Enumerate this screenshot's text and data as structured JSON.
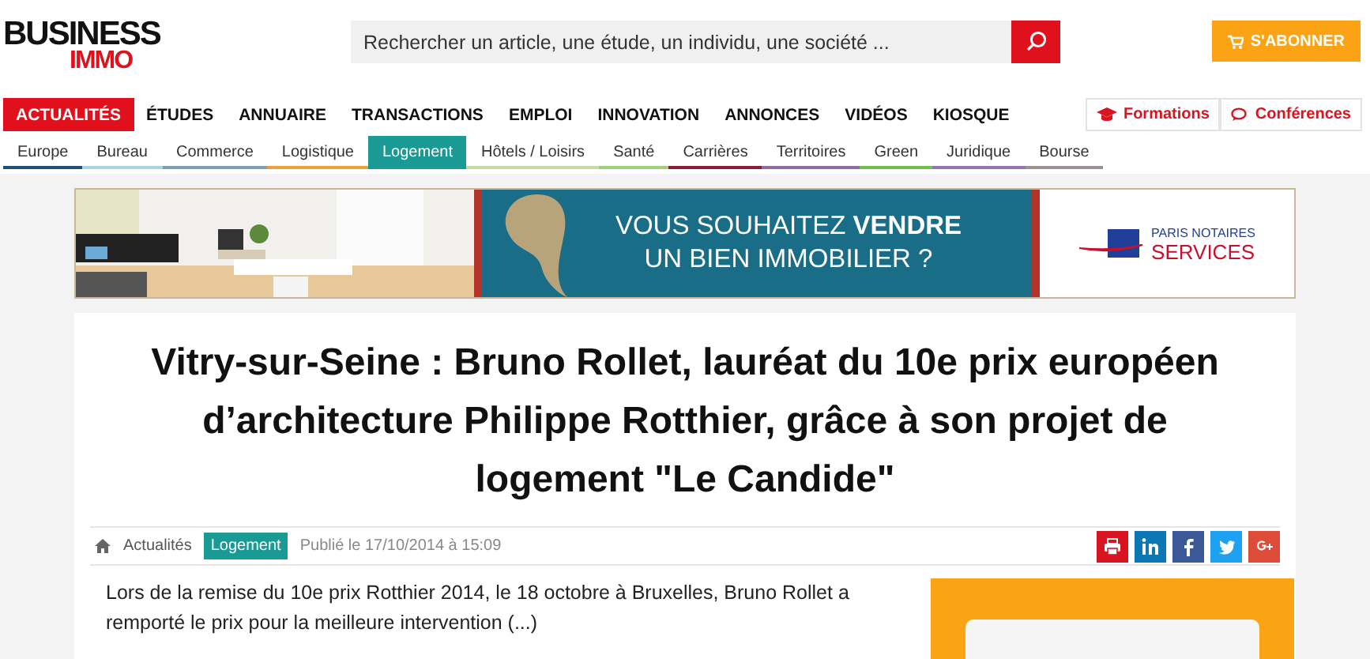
{
  "logo": {
    "top": "BUSINESS",
    "bottom": "IMMO"
  },
  "search": {
    "placeholder": "Rechercher un article, une étude, un individu, une société ..."
  },
  "subscribe": {
    "label": "S'ABONNER"
  },
  "main_nav": [
    {
      "label": "ACTUALITÉS",
      "selected": true
    },
    {
      "label": "ÉTUDES",
      "selected": false
    },
    {
      "label": "ANNUAIRE",
      "selected": false
    },
    {
      "label": "TRANSACTIONS",
      "selected": false
    },
    {
      "label": "EMPLOI",
      "selected": false
    },
    {
      "label": "INNOVATION",
      "selected": false
    },
    {
      "label": "ANNONCES",
      "selected": false
    },
    {
      "label": "VIDÉOS",
      "selected": false
    },
    {
      "label": "KIOSQUE",
      "selected": false
    }
  ],
  "side_links": [
    {
      "kind": "formations",
      "label": "Formations"
    },
    {
      "kind": "conferences",
      "label": "Conférences"
    }
  ],
  "sub_nav": [
    {
      "label": "Europe",
      "color": "#1f4e7a",
      "selected": false
    },
    {
      "label": "Bureau",
      "color": "#a9d3e3",
      "selected": false
    },
    {
      "label": "Commerce",
      "color": "#7d9cb6",
      "selected": false
    },
    {
      "label": "Logistique",
      "color": "#e9a23b",
      "selected": false
    },
    {
      "label": "Logement",
      "color": "#1a9a94",
      "selected": true
    },
    {
      "label": "Hôtels / Loisirs",
      "color": "#c3dca6",
      "selected": false
    },
    {
      "label": "Santé",
      "color": "#9fd07c",
      "selected": false
    },
    {
      "label": "Carrières",
      "color": "#8c1a36",
      "selected": false
    },
    {
      "label": "Territoires",
      "color": "#8e6da3",
      "selected": false
    },
    {
      "label": "Green",
      "color": "#6fc04e",
      "selected": false
    },
    {
      "label": "Juridique",
      "color": "#9b72b2",
      "selected": false
    },
    {
      "label": "Bourse",
      "color": "#9a9090",
      "selected": false
    }
  ],
  "banner": {
    "line1": "VOUS SOUHAITEZ **VENDRE**",
    "line2": "UN BIEN IMMOBILIER ?",
    "brand_top": "PARIS NOTAIRES",
    "brand_bottom": "SERVICES"
  },
  "article": {
    "title": "Vitry-sur-Seine : Bruno Rollet, lauréat du 10e prix européen d’architecture Philippe Rotthier, grâce à son projet de logement \"Le Candide\"",
    "breadcrumb": [
      {
        "kind": "home"
      },
      {
        "kind": "link",
        "label": "Actualités"
      },
      {
        "kind": "tag",
        "label": "Logement"
      }
    ],
    "published": "Publié le 17/10/2014 à 15:09",
    "share": [
      {
        "kind": "print",
        "color": "#d7141f"
      },
      {
        "kind": "linkedin",
        "color": "#0c77b5"
      },
      {
        "kind": "facebook",
        "color": "#3b5998"
      },
      {
        "kind": "twitter",
        "color": "#1da1f2"
      },
      {
        "kind": "googleplus",
        "color": "#dd4b39"
      }
    ],
    "lead": "Lors de la remise du 10e prix Rotthier 2014, le 18 octobre à Bruxelles, Bruno Rollet a remporté le prix pour la meilleure intervention (...)"
  }
}
